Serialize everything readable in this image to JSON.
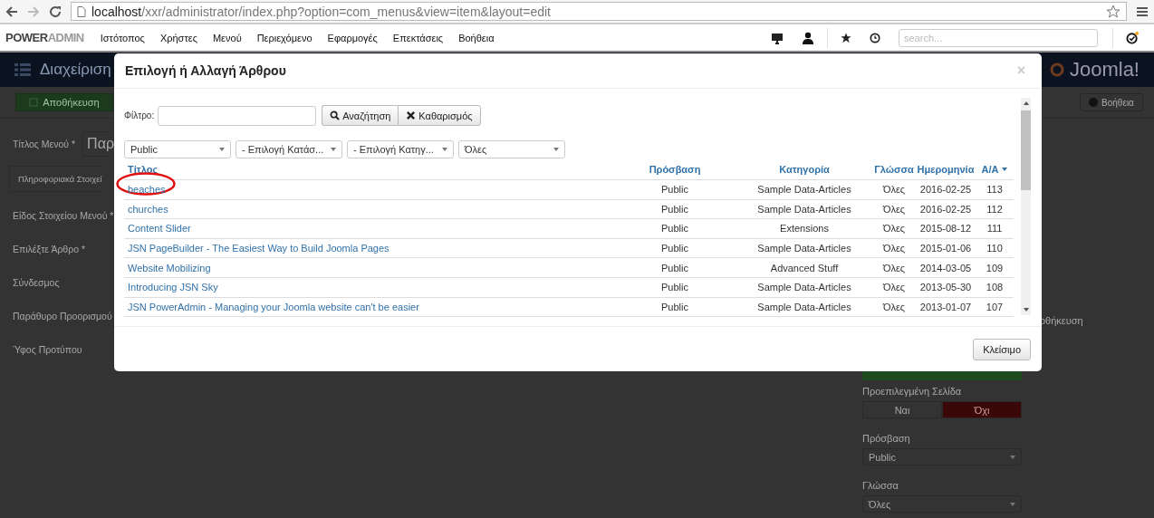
{
  "browser": {
    "url_host": "localhost",
    "url_path": "/xxr/administrator/index.php?option=com_menus&view=item&layout=edit"
  },
  "admin_bar": {
    "brand": "**POWER**ADMIN",
    "menu": [
      "Ιστότοπος",
      "Χρήστες",
      "Μενού",
      "Περιεχόμενο",
      "Εφαρμογές",
      "Επεκτάσεις",
      "Βοήθεια"
    ],
    "search": {
      "placeholder": "search..."
    }
  },
  "page": {
    "title": "Διαχείριση",
    "logo": "Joomla!",
    "save_button": "Αποθήκευση",
    "help_button": "Βοήθεια",
    "menu_title_label": "Τίτλος Μενού *",
    "menu_title_value": "Παρ",
    "tab": "Πληροφοριακά Στοιχεί",
    "labels": [
      "Είδος Στοιχείου Μενού *",
      "Επιλέξτε Άρθρο *",
      "Σύνδεσμος",
      "Παράθυρο Προορισμού",
      "Ύφος Προτύπου"
    ],
    "sidebar": {
      "partial_text": "οθήκευση",
      "default_page": {
        "label": "Προεπιλεγμένη Σελίδα",
        "options": [
          {
            "label": "Ναι",
            "selected": false
          },
          {
            "label": "Όχι",
            "selected": true
          }
        ]
      },
      "access": {
        "label": "Πρόσβαση",
        "value": "Public"
      },
      "language": {
        "label": "Γλώσσα",
        "value": "Όλες"
      }
    }
  },
  "modal": {
    "title": "Επιλογή ή Αλλαγή Άρθρου",
    "close": "×",
    "filter_label": "Φίλτρο:",
    "search_button": "Αναζήτηση",
    "clear_button": "Καθαρισμός",
    "selects": [
      "Public",
      "- Επιλογή Κατάσ...",
      "- Επιλογή Κατηγ...",
      "Όλες"
    ],
    "columns": [
      {
        "label": "Τίτλος",
        "sorted": false
      },
      {
        "label": "Πρόσβαση",
        "sorted": false
      },
      {
        "label": "Κατηγορία",
        "sorted": false
      },
      {
        "label": "Γλώσσα",
        "sorted": false
      },
      {
        "label": "Ημερομηνία",
        "sorted": false
      },
      {
        "label": "Α/Α",
        "sorted": true
      }
    ],
    "rows": [
      {
        "title": "beaches",
        "access": "Public",
        "category": "Sample Data-Articles",
        "language": "Όλες",
        "date": "2016-02-25",
        "id": "113",
        "circled": true
      },
      {
        "title": "churches",
        "access": "Public",
        "category": "Sample Data-Articles",
        "language": "Όλες",
        "date": "2016-02-25",
        "id": "112",
        "circled": false
      },
      {
        "title": "Content Slider",
        "access": "Public",
        "category": "Extensions",
        "language": "Όλες",
        "date": "2015-08-12",
        "id": "111",
        "circled": false
      },
      {
        "title": "JSN PageBuilder - The Easiest Way to Build Joomla Pages",
        "access": "Public",
        "category": "Sample Data-Articles",
        "language": "Όλες",
        "date": "2015-01-06",
        "id": "110",
        "circled": false
      },
      {
        "title": "Website Mobilizing",
        "access": "Public",
        "category": "Advanced Stuff",
        "language": "Όλες",
        "date": "2014-03-05",
        "id": "109",
        "circled": false
      },
      {
        "title": "Introducing JSN Sky",
        "access": "Public",
        "category": "Sample Data-Articles",
        "language": "Όλες",
        "date": "2013-05-30",
        "id": "108",
        "circled": false
      },
      {
        "title": "JSN PowerAdmin - Managing your Joomla website can't be easier",
        "access": "Public",
        "category": "Sample Data-Articles",
        "language": "Όλες",
        "date": "2013-01-07",
        "id": "107",
        "circled": false
      }
    ],
    "close_button": "Κλείσιμο"
  }
}
